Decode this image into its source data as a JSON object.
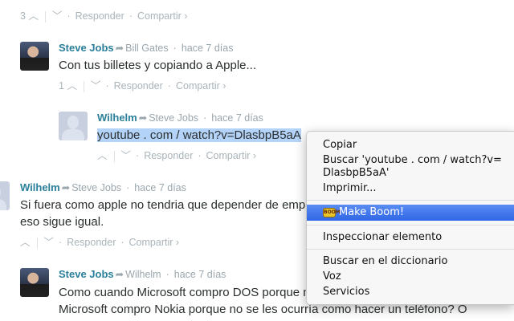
{
  "comments": [
    {
      "votes": {
        "up_count": "3",
        "reply": "Responder",
        "share": "Compartir ›"
      }
    },
    {
      "author": "Steve Jobs",
      "reply_to": "Bill Gates",
      "time": "hace 7 días",
      "text": [
        "Con tus billetes y copiando a Apple..."
      ],
      "votes": {
        "up_count": "1",
        "reply": "Responder",
        "share": "Compartir ›"
      }
    },
    {
      "author": "Wilhelm",
      "reply_to": "Steve Jobs",
      "time": "hace 7 días",
      "text": [
        "youtube . com / watch?v=DlasbpB5aA"
      ],
      "votes": {
        "reply": "Responder",
        "share": "Compartir ›"
      }
    },
    {
      "author": "Wilhelm",
      "reply_to": "Steve Jobs",
      "time": "hace 7 días",
      "text": [
        "Si fuera como apple no tendria que depender de empresas",
        "eso sigue igual."
      ],
      "votes": {
        "reply": "Responder",
        "share": "Compartir ›"
      }
    },
    {
      "author": "Steve Jobs",
      "reply_to": "Wilhelm",
      "time": "hace 7 días",
      "text": [
        "Como cuando Microsoft compro DOS porque no tenían nada o cuando",
        "Microsoft compro Nokia porque no se les ocurría como hacer un teléfono? O"
      ]
    }
  ],
  "context_menu": {
    "items": [
      "Copiar",
      "Buscar 'youtube . com / watch?v=DlasbpB5aA'",
      "Imprimir...",
      "Make Boom!",
      "Inspeccionar elemento",
      "Buscar en el diccionario",
      "Voz",
      "Servicios"
    ],
    "highlight_color": "#3a70e8"
  }
}
